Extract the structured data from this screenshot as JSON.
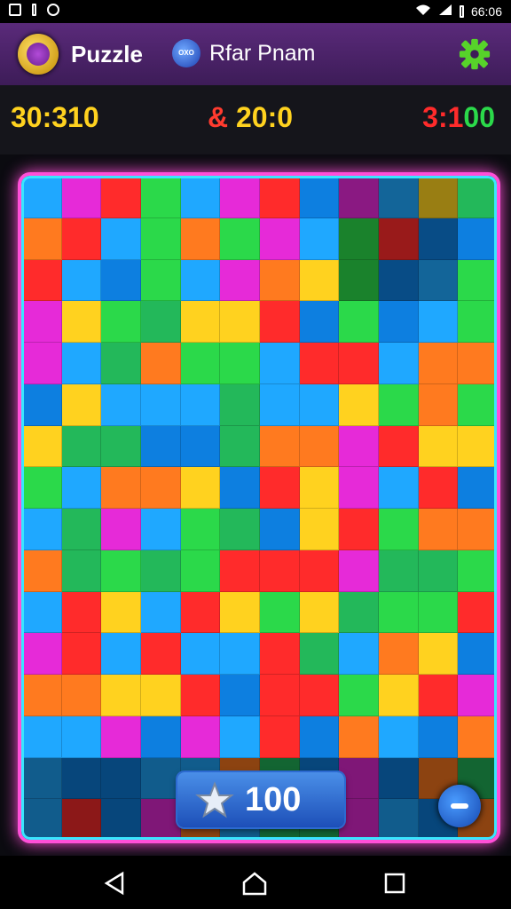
{
  "status_bar": {
    "time": "66:06",
    "icons": [
      "signal-icon",
      "notification-icon",
      "wifi-icon",
      "cell-signal-icon",
      "battery-icon"
    ]
  },
  "header": {
    "app_title": "Puzzle",
    "badge_text": "OXO",
    "player_name": "Rfar Pnam",
    "icons": [
      "app-logo-icon",
      "player-badge-icon",
      "settings-gear-icon"
    ]
  },
  "scores": {
    "left": "30:310",
    "middle_prefix": "&",
    "middle_value": "20:0",
    "right_prefix": "3:1",
    "right_value": "00"
  },
  "board": {
    "colors": [
      "#ff2b2b",
      "#2bd94a",
      "#ffd21f",
      "#1fa8ff",
      "#e62ad8",
      "#ff7a1f",
      "#23b85a",
      "#0d7fe0"
    ]
  },
  "actions": {
    "coin_value": "100",
    "coin_icon": "star-coin-icon",
    "round_button_icon": "minus-icon"
  },
  "nav": {
    "icons": [
      "back-icon",
      "home-icon",
      "recents-icon"
    ]
  }
}
